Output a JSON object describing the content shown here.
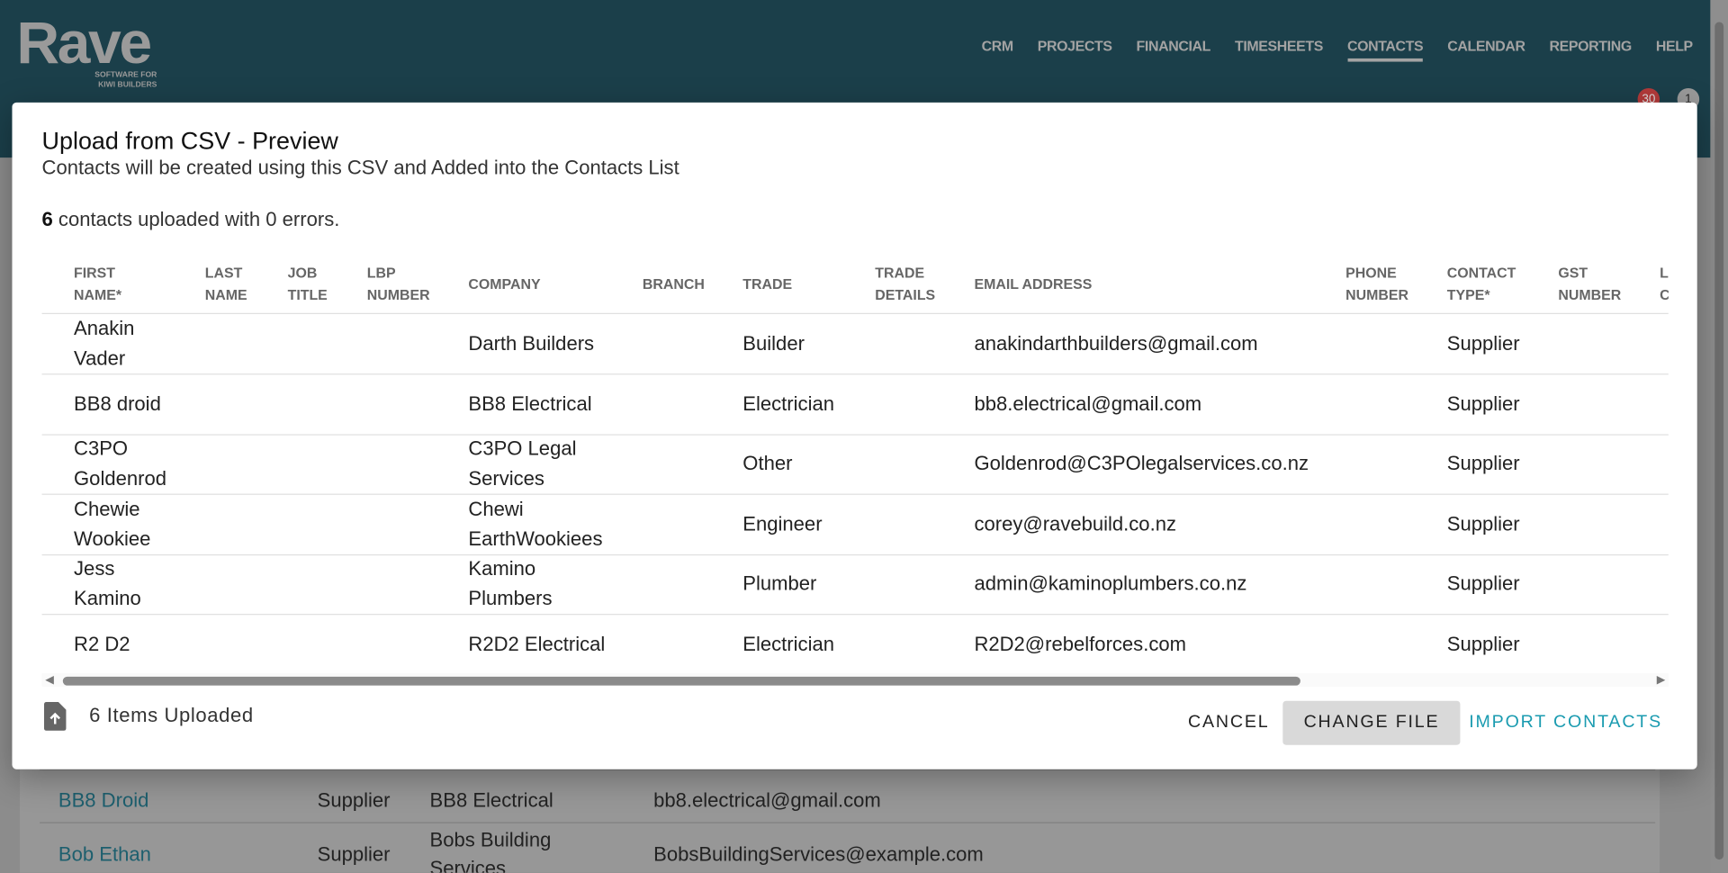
{
  "app": {
    "logo": "Rave",
    "logo_tagline_1": "SOFTWARE FOR",
    "logo_tagline_2": "KIWI BUILDERS"
  },
  "nav": {
    "items": [
      "CRM",
      "PROJECTS",
      "FINANCIAL",
      "TIMESHEETS",
      "CONTACTS",
      "CALENDAR",
      "REPORTING",
      "HELP"
    ],
    "active": "CONTACTS"
  },
  "badges": {
    "notifications": "30",
    "messages": "1"
  },
  "modal": {
    "title": "Upload from CSV - Preview",
    "subtitle": "Contacts will be created using this CSV and Added into the Contacts List",
    "summary_count": "6",
    "summary_text": " contacts uploaded with 0 errors.",
    "columns": [
      [
        "FIRST",
        "NAME*"
      ],
      [
        "LAST",
        "NAME"
      ],
      [
        "JOB",
        "TITLE"
      ],
      [
        "LBP",
        "NUMBER"
      ],
      [
        "COMPANY",
        ""
      ],
      [
        "BRANCH",
        ""
      ],
      [
        "TRADE",
        ""
      ],
      [
        "TRADE",
        "DETAILS"
      ],
      [
        "EMAIL ADDRESS",
        ""
      ],
      [
        "PHONE",
        "NUMBER"
      ],
      [
        "CONTACT",
        "TYPE*"
      ],
      [
        "GST",
        "NUMBER"
      ],
      [
        "LAI",
        "CO"
      ]
    ],
    "rows": [
      {
        "first": "Anakin Vader",
        "company": "Darth Builders",
        "trade": "Builder",
        "email": "anakindarthbuilders@gmail.com",
        "type": "Supplier"
      },
      {
        "first": "BB8 droid",
        "company": "BB8 Electrical",
        "trade": "Electrician",
        "email": "bb8.electrical@gmail.com",
        "type": "Supplier"
      },
      {
        "first": "C3PO Goldenrod",
        "company": "C3PO Legal Services",
        "trade": "Other",
        "email": "Goldenrod@C3POlegalservices.co.nz",
        "type": "Supplier"
      },
      {
        "first": "Chewie Wookiee",
        "company": "Chewi EarthWookiees",
        "trade": "Engineer",
        "email": "corey@ravebuild.co.nz",
        "type": "Supplier"
      },
      {
        "first": "Jess Kamino",
        "company": "Kamino Plumbers",
        "trade": "Plumber",
        "email": "admin@kaminoplumbers.co.nz",
        "type": "Supplier"
      },
      {
        "first": "R2 D2",
        "company": "R2D2 Electrical",
        "trade": "Electrician",
        "email": "R2D2@rebelforces.com",
        "type": "Supplier"
      }
    ],
    "items_uploaded": "6 Items Uploaded",
    "buttons": {
      "cancel": "CANCEL",
      "change_file": "CHANGE FILE",
      "import": "IMPORT CONTACTS"
    }
  },
  "background_list": [
    {
      "name": "BB8 Droid",
      "type": "Supplier",
      "company": "BB8 Electrical",
      "email": "bb8.electrical@gmail.com"
    },
    {
      "name": "Bob Ethan",
      "type": "Supplier",
      "company": "Bobs Building Services",
      "email": "BobsBuildingServices@example.com"
    }
  ],
  "colors": {
    "header": "#1b3f4a",
    "accent": "#1a9bb0",
    "change_file_bg": "#d9d9d9"
  }
}
